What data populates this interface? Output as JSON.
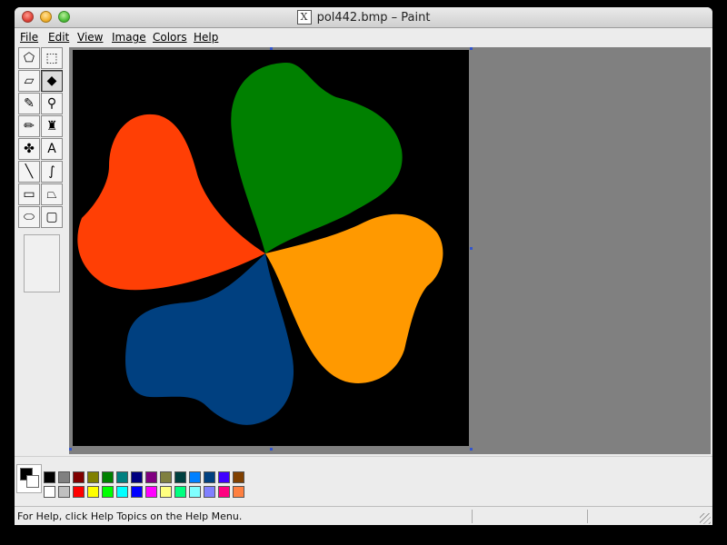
{
  "window": {
    "title": "pol442.bmp – Paint",
    "title_icon_glyph": "X"
  },
  "menu": [
    "File",
    "Edit",
    "View",
    "Image",
    "Colors",
    "Help"
  ],
  "tools": [
    {
      "name": "free-form-select-icon",
      "glyph": "⬠"
    },
    {
      "name": "rect-select-icon",
      "glyph": "⬚"
    },
    {
      "name": "eraser-icon",
      "glyph": "▱"
    },
    {
      "name": "fill-bucket-icon",
      "glyph": "◆"
    },
    {
      "name": "color-picker-icon",
      "glyph": "✎"
    },
    {
      "name": "magnifier-icon",
      "glyph": "⚲"
    },
    {
      "name": "pencil-icon",
      "glyph": "✏"
    },
    {
      "name": "brush-icon",
      "glyph": "♜"
    },
    {
      "name": "airbrush-icon",
      "glyph": "✤"
    },
    {
      "name": "text-icon",
      "glyph": "A"
    },
    {
      "name": "line-icon",
      "glyph": "╲"
    },
    {
      "name": "curve-icon",
      "glyph": "∫"
    },
    {
      "name": "rectangle-icon",
      "glyph": "▭"
    },
    {
      "name": "polygon-icon",
      "glyph": "⏢"
    },
    {
      "name": "ellipse-icon",
      "glyph": "⬭"
    },
    {
      "name": "rounded-rect-icon",
      "glyph": "▢"
    }
  ],
  "active_tool": "fill-bucket-icon",
  "canvas": {
    "background": "#000000",
    "shapes": [
      {
        "name": "red-petal",
        "color": "#ff3f05"
      },
      {
        "name": "green-petal",
        "color": "#008000"
      },
      {
        "name": "orange-petal",
        "color": "#ff9900"
      },
      {
        "name": "blue-petal",
        "color": "#004080"
      }
    ]
  },
  "colors": {
    "foreground": "#000000",
    "background": "#ffffff",
    "palette_top": [
      "#000000",
      "#808080",
      "#800000",
      "#808000",
      "#008000",
      "#008080",
      "#000080",
      "#800080",
      "#808040",
      "#004040",
      "#0080ff",
      "#004080",
      "#4000ff",
      "#804000"
    ],
    "palette_bottom": [
      "#ffffff",
      "#c0c0c0",
      "#ff0000",
      "#ffff00",
      "#00ff00",
      "#00ffff",
      "#0000ff",
      "#ff00ff",
      "#ffff80",
      "#00ff80",
      "#80ffff",
      "#8080ff",
      "#ff0080",
      "#ff8040"
    ]
  },
  "status": {
    "help_text": "For Help, click Help Topics on the Help Menu."
  }
}
